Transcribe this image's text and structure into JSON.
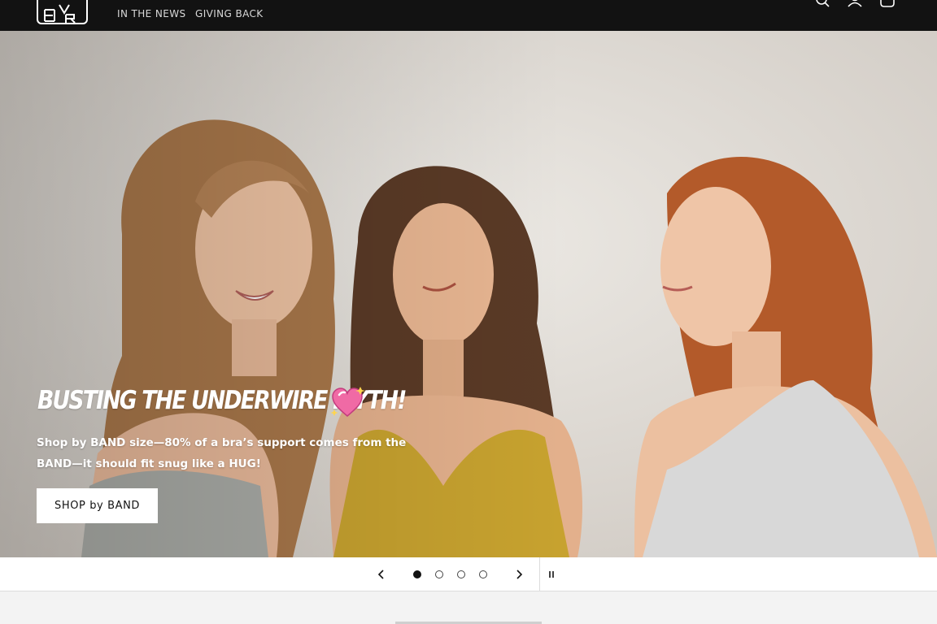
{
  "header": {
    "logo_letters": [
      "B",
      "R",
      "A",
      "V",
      "A"
    ],
    "nav": [
      {
        "label": "IN THE NEWS"
      },
      {
        "label": "GIVING BACK"
      }
    ],
    "icons": [
      "search-icon",
      "account-icon",
      "cart-icon"
    ]
  },
  "hero": {
    "heading": "BUSTING THE UNDERWIRE MYTH!",
    "heading_emoji": "sparkling-heart-icon",
    "subtext": "Shop by BAND size—80% of a bra’s support comes from the BAND—it should fit snug like a HUG!",
    "button_label": "SHOP by BAND"
  },
  "slider": {
    "slide_count": 4,
    "active_slide": 1,
    "controls": [
      "previous-icon",
      "next-icon",
      "pause-icon"
    ]
  },
  "colors": {
    "header_bg": "#121212",
    "hero_text": "#ffffff",
    "button_bg": "#ffffff",
    "button_text": "#121212",
    "dot_active": "#121212"
  }
}
